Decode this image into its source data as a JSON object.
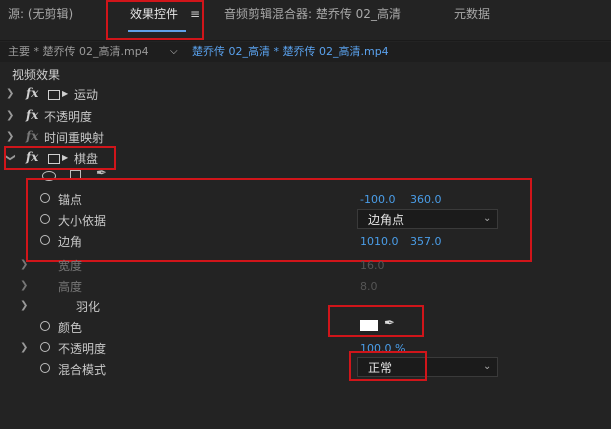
{
  "tabs": {
    "source": "源: (无剪辑)",
    "effect_controls": "效果控件",
    "menu_glyph": "≡",
    "audio_mixer": "音频剪辑混合器: 楚乔传 02_高清",
    "metadata": "元数据"
  },
  "header": {
    "master_clip": "主要 * 楚乔传 02_高清.mp4",
    "sequence_clip": "楚乔传 02_高清 * 楚乔传 02_高清.mp4"
  },
  "section_title": "视频效果",
  "effects": {
    "motion": "运动",
    "opacity": "不透明度",
    "time_remap": "时间重映射",
    "checkerboard": "棋盘"
  },
  "props": {
    "anchor": {
      "label": "锚点",
      "x": "-100.0",
      "y": "360.0"
    },
    "size_from": {
      "label": "大小依据",
      "value": "边角点"
    },
    "corner": {
      "label": "边角",
      "x": "1010.0",
      "y": "357.0"
    },
    "width": {
      "label": "宽度",
      "value": "16.0"
    },
    "height": {
      "label": "高度",
      "value": "8.0"
    },
    "feather": {
      "label": "羽化"
    },
    "color": {
      "label": "颜色",
      "swatch": "#ffffff"
    },
    "opacity": {
      "label": "不透明度",
      "value": "100.0 %"
    },
    "blend_mode": {
      "label": "混合模式",
      "value": "正常"
    }
  },
  "colors": {
    "accent_blue": "#4a9de8",
    "highlight_red": "#d0151a",
    "background": "#232323"
  }
}
